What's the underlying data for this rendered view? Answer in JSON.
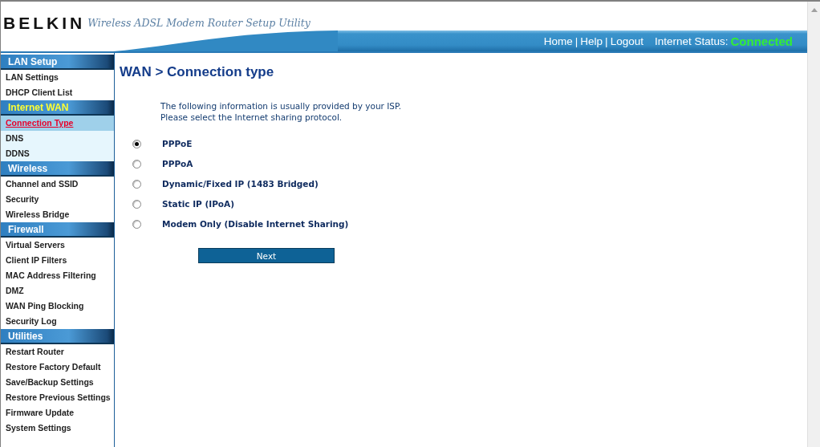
{
  "header": {
    "logo": "BELKIN",
    "subtitle": "Wireless ADSL Modem Router Setup Utility",
    "links": [
      "Home",
      "Help",
      "Logout"
    ],
    "separator": "|",
    "status_label": "Internet Status:",
    "status_value": "Connected"
  },
  "sidebar": {
    "sections": [
      {
        "title": "LAN Setup",
        "selected": false,
        "items": [
          {
            "label": "LAN Settings",
            "selected": false
          },
          {
            "label": "DHCP Client List",
            "selected": false
          }
        ]
      },
      {
        "title": "Internet WAN",
        "selected": true,
        "items": [
          {
            "label": "Connection Type",
            "selected": true
          },
          {
            "label": "DNS",
            "selected": false
          },
          {
            "label": "DDNS",
            "selected": false
          }
        ]
      },
      {
        "title": "Wireless",
        "selected": false,
        "items": [
          {
            "label": "Channel and SSID",
            "selected": false
          },
          {
            "label": "Security",
            "selected": false
          },
          {
            "label": "Wireless Bridge",
            "selected": false
          }
        ]
      },
      {
        "title": "Firewall",
        "selected": false,
        "items": [
          {
            "label": "Virtual Servers",
            "selected": false
          },
          {
            "label": "Client IP Filters",
            "selected": false
          },
          {
            "label": "MAC Address Filtering",
            "selected": false
          },
          {
            "label": "DMZ",
            "selected": false
          },
          {
            "label": "WAN Ping Blocking",
            "selected": false
          },
          {
            "label": "Security Log",
            "selected": false
          }
        ]
      },
      {
        "title": "Utilities",
        "selected": false,
        "items": [
          {
            "label": "Restart Router",
            "selected": false
          },
          {
            "label": "Restore Factory Default",
            "selected": false
          },
          {
            "label": "Save/Backup Settings",
            "selected": false
          },
          {
            "label": "Restore Previous Settings",
            "selected": false
          },
          {
            "label": "Firmware Update",
            "selected": false
          },
          {
            "label": "System Settings",
            "selected": false
          }
        ]
      }
    ]
  },
  "content": {
    "title": "WAN > Connection type",
    "intro": [
      "The following information is usually provided by your ISP.",
      "Please select the Internet sharing protocol."
    ],
    "options": [
      {
        "label": "PPPoE",
        "selected": true
      },
      {
        "label": "PPPoA",
        "selected": false
      },
      {
        "label": "Dynamic/Fixed IP (1483 Bridged)",
        "selected": false
      },
      {
        "label": "Static IP (IPoA)",
        "selected": false
      },
      {
        "label": "Modem Only (Disable Internet Sharing)",
        "selected": false
      }
    ],
    "button": "Next"
  }
}
